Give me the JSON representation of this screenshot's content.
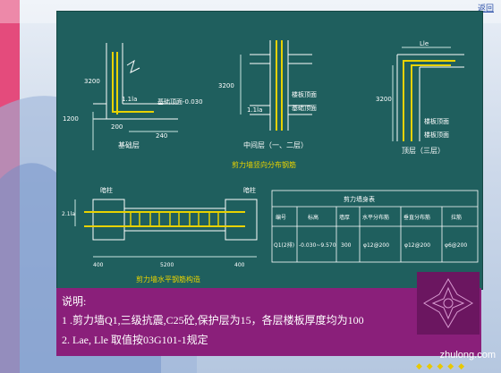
{
  "top_link": "返回",
  "diagrams": {
    "foundation": {
      "labels": [
        "基础顶面-0.030",
        "1.1la",
        "3200",
        "1200",
        "200",
        "240"
      ],
      "caption": "基础层"
    },
    "middle": {
      "labels": [
        "3200",
        "楼板顶面",
        "基础顶面",
        "1.1la"
      ],
      "caption": "中间层（一、二层）"
    },
    "top": {
      "labels": [
        "Lle",
        "3200",
        "楼板顶面",
        "楼板顶面"
      ],
      "caption": "顶层（三层）"
    },
    "vertical_title": "剪力墙竖向分布钢筋",
    "horizontal": {
      "labels": [
        "暗柱",
        "暗柱",
        "2.1la",
        "400",
        "5200",
        "400"
      ],
      "caption": "剪力墙水平钢筋构造"
    }
  },
  "table": {
    "title": "剪力墙身表",
    "headers": [
      "编号",
      "标高",
      "墙厚",
      "水平分布筋",
      "垂直分布筋",
      "拉筋"
    ],
    "rows": [
      [
        "Q1(2排)",
        "-0.030~9.570",
        "300",
        "φ12@200",
        "φ12@200",
        "φ6@200"
      ]
    ]
  },
  "notes": {
    "title": "说明:",
    "items": [
      "1 .剪力墙Q1,三级抗震,C25砼,保护层为15，各层楼板厚度均为100",
      "2. Lae, Lle 取值按03G101-1规定"
    ]
  },
  "watermark": "zhulong.com",
  "footer_text": "◆ ◆ ◆ ◆ ◆",
  "colors": {
    "panel": "#1f5f5e",
    "notes": "#8a1f7a",
    "line": "#ffffff",
    "rebar": "#e8d200",
    "dim": "#c9e6e0"
  }
}
